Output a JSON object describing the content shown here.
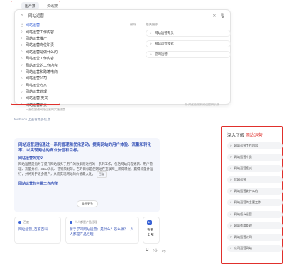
{
  "top_tabs": [
    {
      "label": "图片搜",
      "active": true
    },
    {
      "label": "资讯搜",
      "active": false
    }
  ],
  "search": {
    "value": "网站运营",
    "icons": [
      "search-icon",
      "clear-icon",
      "voice-icon"
    ]
  },
  "suggestions": [
    "网站运营",
    "网站运营工作内容",
    "网站运营推广",
    "网站运营岗位职责",
    "网站运营是做什么的",
    "网站运营工作内容",
    "网站运营的工作内容",
    "网站运营和跨境电商",
    "网站运营公司",
    "网站运营方案",
    "网站运营管理",
    "网站运营 英文",
    "网站运营职责"
  ],
  "history": {
    "label": "删除"
  },
  "related": {
    "title": "相关搜索",
    "items": [
      "网站运营专员",
      "网站运营模式",
      "官网运营"
    ]
  },
  "panel_footer": "针对这些搜索建议提供反馈",
  "behind_text": "一直在跟进网站运营的实施进度",
  "source_line": "feishu.cn 上查看更多信息",
  "answer": {
    "headline": "网站运营是指通过一系列管理和优化活动，提高网站的用户体验、流量和转化率，以实现网站的商业价值和目标。",
    "sub1": "网站运营的定义",
    "body": "网站运营是指为了提升网站服务于用户的效果而进行的一系列工作，包括网站内容更新、用户管理、流量分析、SEO优化、营销策划等。它的目标是使网站在互联网上获得曝光、赢得流量并运行，并将对于更多用户，从而实现网站的价值最大化。",
    "chip": "百度",
    "sub2": "网站运营的主要工作内容",
    "expand": "展开更多"
  },
  "mini_cards": [
    {
      "source": "百度",
      "title": "网站运营_百度百科"
    },
    {
      "source": "人人都是产品经理",
      "title": "新手学习网站运营：是什么？怎么做？ | 人人都是产品经理"
    },
    {
      "source": "",
      "title": "查看全部"
    }
  ],
  "feedback_icons": [
    "copy-icon",
    "like-icon",
    "dislike-icon"
  ],
  "deep": {
    "title_prefix": "深入了解",
    "title_keyword": "网站运营",
    "items": [
      "网站运营工作内容",
      "网站运营专员",
      "网站运营模式",
      "官网运营",
      "网站运营做什么的",
      "网站运营的主要工作",
      "网站怎么运营",
      "网站作用管理",
      "网站运营公司",
      "公司运营网站"
    ]
  },
  "colors": {
    "highlight": "#e0302c",
    "link": "#3a56b8",
    "accent": "#3a63d6"
  }
}
